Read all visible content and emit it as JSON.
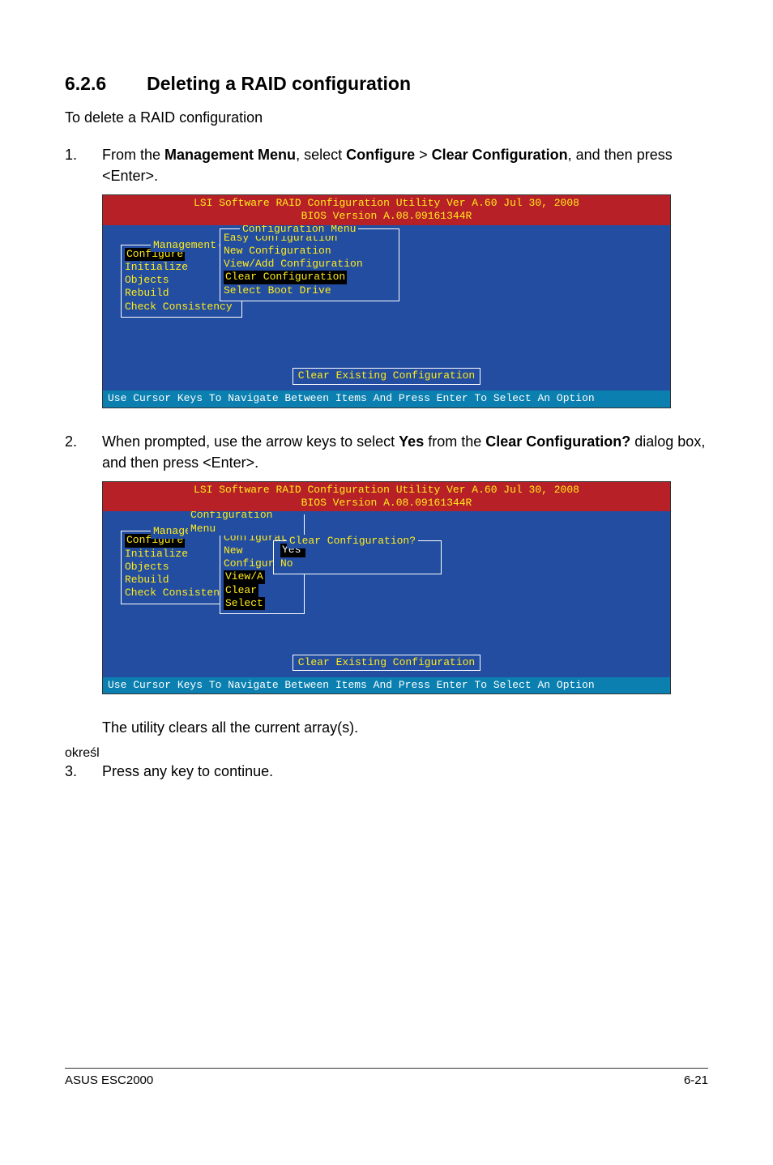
{
  "section": {
    "number": "6.2.6",
    "title": "Deleting a RAID configuration",
    "intro": "To delete a RAID configuration"
  },
  "steps": {
    "s1": {
      "num": "1.",
      "pre": "From the ",
      "b1": "Management Menu",
      "mid1": ", select ",
      "b2": "Configure",
      "gt": " > ",
      "b3": "Clear Configuration",
      "post": ", and then press <Enter>."
    },
    "s2": {
      "num": "2.",
      "pre": "When prompted, use the arrow keys to select ",
      "b1": "Yes",
      "mid": " from the ",
      "b2": "Clear Configuration?",
      "post": " dialog box, and then press <Enter>."
    },
    "s2b": "The utility clears all the current array(s).",
    "s3": {
      "num": "3.",
      "text": "Press any key to continue."
    }
  },
  "bios": {
    "title1": "LSI Software RAID Configuration Utility Ver A.60 Jul 30, 2008",
    "title2": "BIOS Version  A.08.09161344R",
    "help": "Use Cursor Keys To Navigate Between Items And Press Enter To Select An Option",
    "statusbox": "Clear Existing Configuration",
    "mgmt": {
      "title": "Management",
      "items": [
        "Configure",
        "Initialize",
        "Objects",
        "Rebuild",
        "Check Consistency"
      ]
    },
    "cfg": {
      "title": "Configuration Menu",
      "items": [
        "Easy Configuration",
        "New Configuration",
        "View/Add Configuration",
        "Clear Configuration",
        "Select Boot Drive"
      ]
    },
    "cfg2": {
      "items_trunc": [
        "View/A",
        "Clear",
        "Select"
      ]
    },
    "dlg": {
      "title": "Clear Configuration?",
      "yes": "Yes",
      "no": "No"
    }
  },
  "footer": {
    "left": "ASUS ESC2000",
    "right": "6-21"
  },
  "chart_data": null
}
